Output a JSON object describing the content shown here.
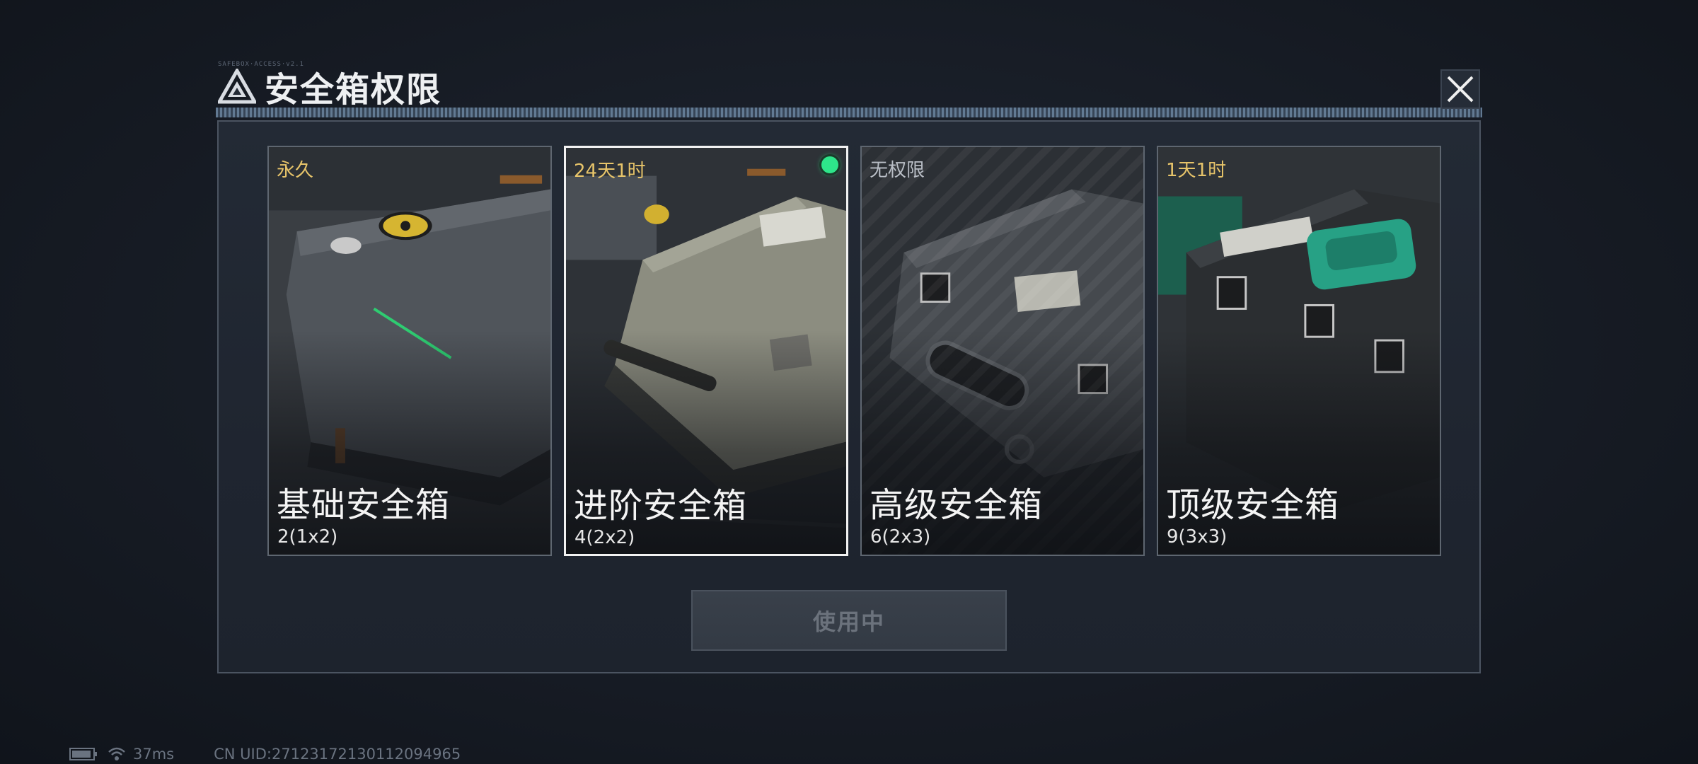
{
  "dialog": {
    "title": "安全箱权限",
    "title_tag": "SAFEBOX·ACCESS·v2.1",
    "action_label": "使用中"
  },
  "cards": [
    {
      "status": "永久",
      "name": "基础安全箱",
      "size": "2(1x2)",
      "selected": false
    },
    {
      "status": "24天1时",
      "name": "进阶安全箱",
      "size": "4(2x2)",
      "selected": true
    },
    {
      "status": "无权限",
      "name": "高级安全箱",
      "size": "6(2x3)",
      "selected": false
    },
    {
      "status": "1天1时",
      "name": "顶级安全箱",
      "size": "9(3x3)",
      "selected": false
    }
  ],
  "footer": {
    "ping": "37ms",
    "uid": "CN UID:27123172130112094965"
  },
  "colors": {
    "status_gold": "#e7c46a",
    "active_green": "#2ee58a",
    "panel": "#1f2530",
    "border": "#4b5461"
  },
  "icons": [
    "logo-icon",
    "close-icon",
    "battery-icon",
    "wifi-icon"
  ]
}
